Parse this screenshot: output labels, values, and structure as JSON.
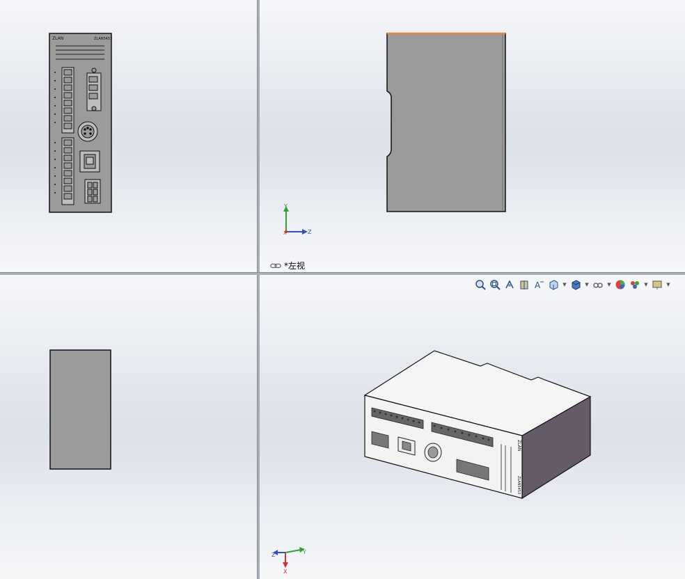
{
  "viewports": {
    "top_left": {
      "name": "front-view"
    },
    "top_right": {
      "name": "left-view",
      "label": "*左视"
    },
    "bottom_left": {
      "name": "top-view"
    },
    "bottom_right": {
      "name": "isometric-view"
    }
  },
  "triad": {
    "x": "X",
    "y": "Y",
    "z": "Z"
  },
  "device": {
    "brand": "ZLAN",
    "model": "ZLAN5453"
  },
  "colors": {
    "face_gray": "#9b9b9b",
    "face_side": "#655a68",
    "edge_highlight": "#e58a2a",
    "axis_x": "#d43030",
    "axis_y": "#30a030",
    "axis_z": "#3050c8"
  },
  "toolbar": {
    "items": [
      {
        "icon": "zoom-to-fit-icon"
      },
      {
        "icon": "zoom-to-area-icon"
      },
      {
        "icon": "previous-view-icon"
      },
      {
        "icon": "section-view-icon"
      },
      {
        "icon": "dynamic-annotation-icon"
      },
      {
        "icon": "view-orientation-icon"
      },
      {
        "icon": "display-style-icon"
      },
      {
        "icon": "hide-show-items-icon"
      },
      {
        "icon": "edit-appearance-icon"
      },
      {
        "icon": "apply-scene-icon"
      },
      {
        "icon": "view-settings-icon"
      }
    ]
  }
}
